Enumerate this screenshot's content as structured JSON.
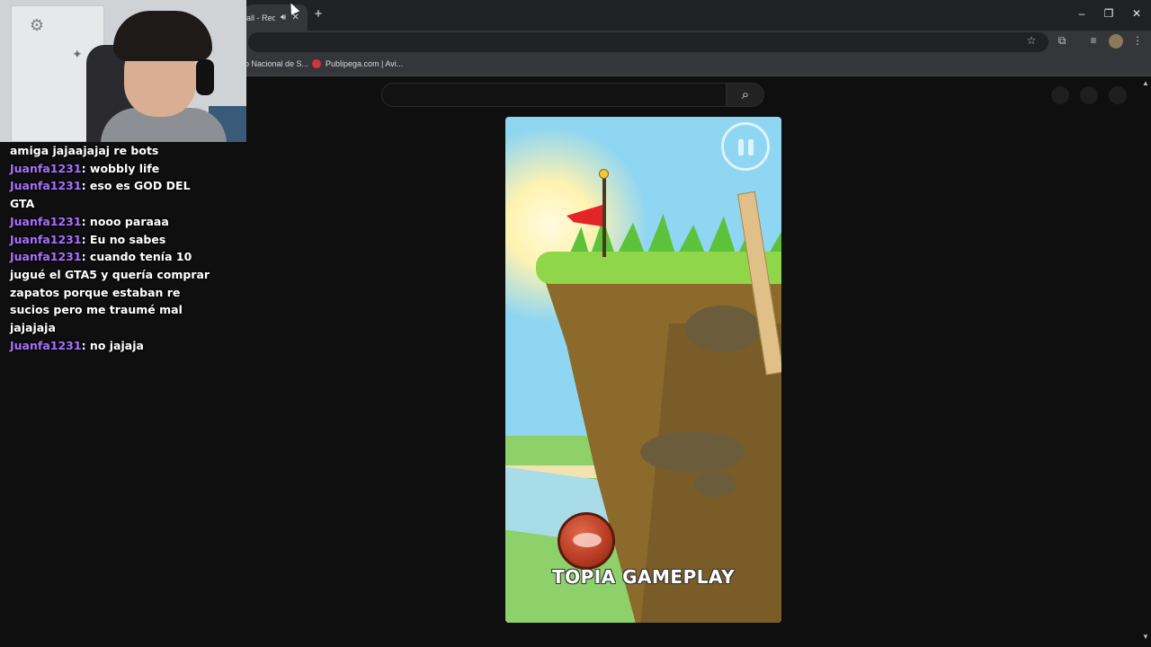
{
  "browser": {
    "tab": {
      "title": "all - Red",
      "audio_icon": "speaker-icon",
      "close_glyph": "✕"
    },
    "new_tab_glyph": "+",
    "window_controls": {
      "minimize": "–",
      "restore": "❐",
      "close": "✕"
    },
    "toolbar_icons": {
      "star": "☆",
      "extensions": "⧉",
      "media": "≡",
      "menu": "⋮"
    },
    "bookmarks": [
      {
        "label": "o Nacional de S..."
      },
      {
        "label": "Publipega.com | Avi..."
      }
    ]
  },
  "site": {
    "search": {
      "placeholder": "",
      "button_glyph": "⌕"
    }
  },
  "chat": [
    {
      "user": "",
      "message": "amiga jajaajajaj re bots"
    },
    {
      "user": "Juanfa1231",
      "message": "wobbly life"
    },
    {
      "user": "Juanfa1231",
      "message": "eso es GOD DEL GTA"
    },
    {
      "user": "Juanfa1231",
      "message": "nooo paraaa"
    },
    {
      "user": "Juanfa1231",
      "message": "Eu no sabes"
    },
    {
      "user": "Juanfa1231",
      "message": "cuando tenía 10 jugué el GTA5 y quería comprar zapatos porque estaban re sucios pero me traumé mal jajajaja"
    },
    {
      "user": "Juanfa1231",
      "message": "no jajaja"
    }
  ],
  "game": {
    "watermark": "TOPIA GAMEPLAY",
    "pause_icon": "pause-icon"
  },
  "colors": {
    "chat_user": "#a970ff",
    "flag": "#e32428",
    "sky": "#8fd6f2"
  }
}
